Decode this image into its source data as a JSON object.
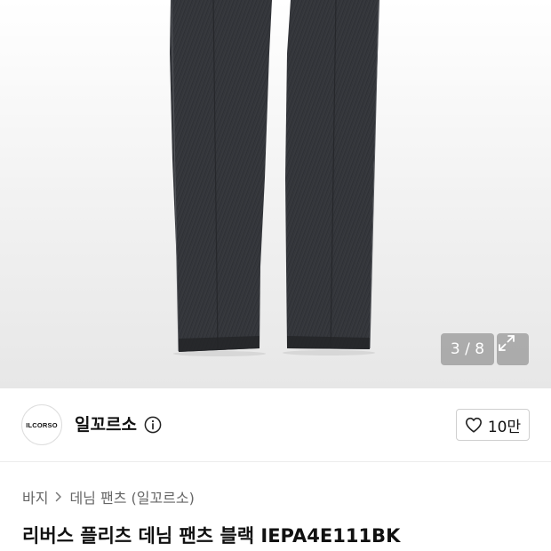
{
  "gallery": {
    "counter": "3 / 8",
    "expand_icon": "expand-icon"
  },
  "shop": {
    "logo_text": "ILCORSO",
    "name": "일꼬르소",
    "info_icon": "info-icon"
  },
  "like": {
    "icon": "heart-icon",
    "count": "10만"
  },
  "breadcrumb": {
    "level1": "바지",
    "level2": "데님 팬츠 (일꼬르소)"
  },
  "product": {
    "title": "리버스 플리츠 데님 팬츠 블랙 IEPA4E111BK"
  }
}
